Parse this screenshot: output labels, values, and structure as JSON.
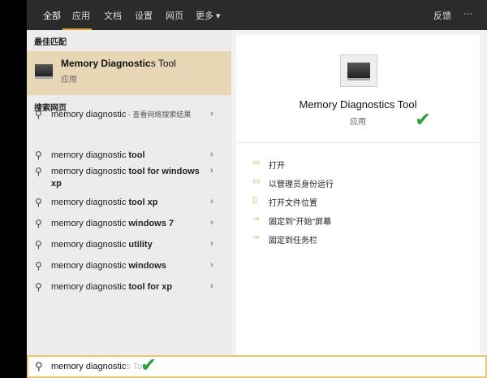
{
  "tabs": [
    "全部",
    "应用",
    "文档",
    "设置",
    "网页",
    "更多 ▾"
  ],
  "feedback": "反馈",
  "more": "···",
  "best_match_header": "最佳匹配",
  "best": {
    "title_bold": "Memory Diagnostic",
    "title_rest": "s Tool",
    "sub": "应用"
  },
  "web_header": "搜索网页",
  "results": [
    {
      "a": "memory diagnostic",
      "b": " - 查看网络搜索结果",
      "bold": false
    },
    {
      "a": "memory diagnostic ",
      "b": "tool",
      "bold": true
    },
    {
      "a": "memory diagnostic ",
      "b": "tool for windows xp",
      "bold": true
    },
    {
      "a": "memory diagnostic ",
      "b": "tool xp",
      "bold": true
    },
    {
      "a": "memory diagnostic ",
      "b": "windows 7",
      "bold": true
    },
    {
      "a": "memory diagnostic ",
      "b": "utility",
      "bold": true
    },
    {
      "a": "memory diagnostic ",
      "b": "windows",
      "bold": true
    },
    {
      "a": "memory diagnostic ",
      "b": "tool for xp",
      "bold": true
    }
  ],
  "detail": {
    "title": "Memory Diagnostics Tool",
    "sub": "应用"
  },
  "actions": [
    "打开",
    "以管理员身份运行",
    "打开文件位置",
    "固定到\"开始\"屏幕",
    "固定到任务栏"
  ],
  "search": {
    "value": "memory diagnostic",
    "ghost": "s Tool"
  },
  "accent": "#e8a33d"
}
